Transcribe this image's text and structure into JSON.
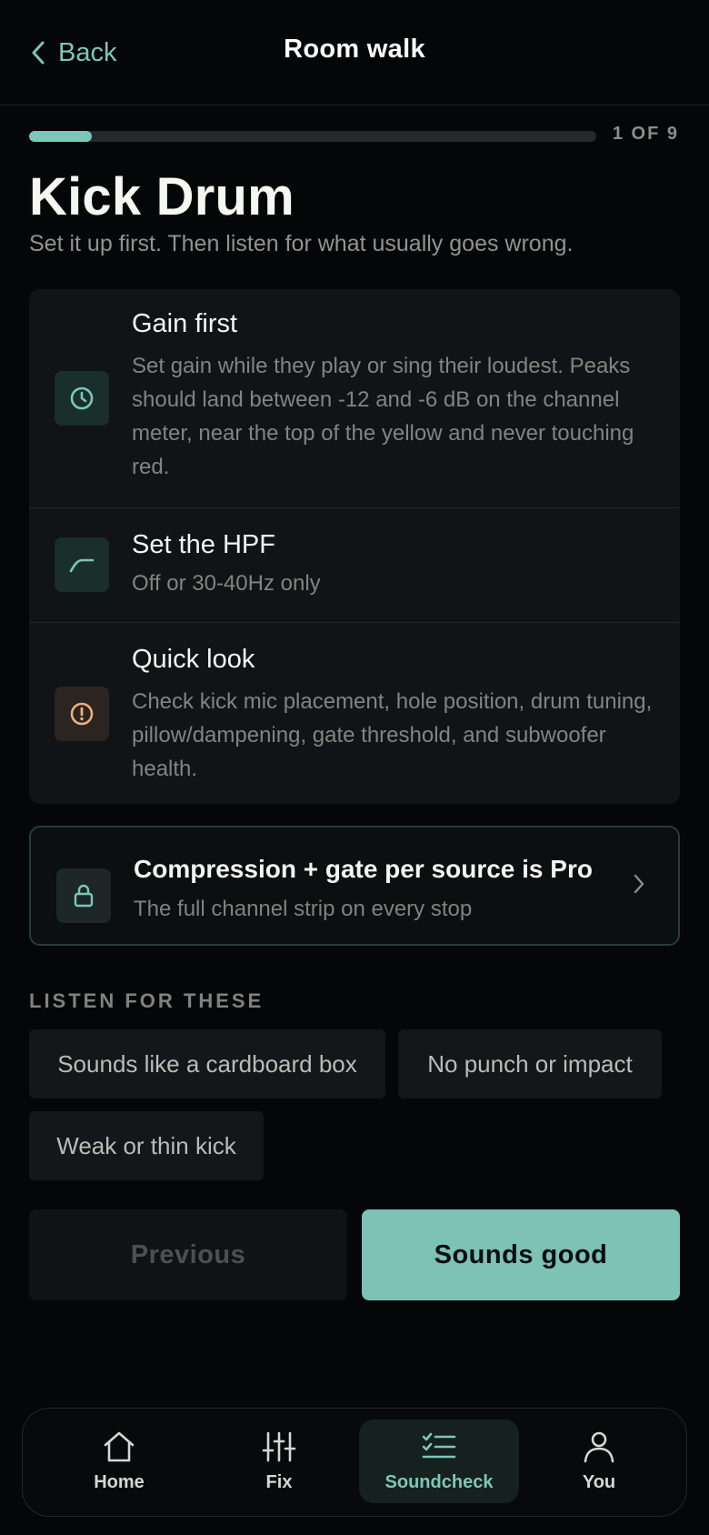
{
  "header": {
    "back_label": "Back",
    "title": "Room walk"
  },
  "progress": {
    "label": "1 OF 9",
    "current": 1,
    "total": 9
  },
  "page": {
    "title": "Kick Drum",
    "subtitle": "Set it up first. Then listen for what usually goes wrong."
  },
  "steps": [
    {
      "title": "Gain first",
      "body": "Set gain while they play or sing their loudest. Peaks should land between -12 and -6 dB on the channel meter, near the top of the yellow and never touching red.",
      "icon": "clock-icon"
    },
    {
      "title": "Set the HPF",
      "body": "Off or 30-40Hz only",
      "icon": "hpf-curve-icon"
    },
    {
      "title": "Quick look",
      "body": "Check kick mic placement, hole position, drum tuning, pillow/dampening, gate threshold, and subwoofer health.",
      "icon": "alert-icon"
    }
  ],
  "pro_banner": {
    "title": "Compression + gate per source is Pro",
    "subtitle": "The full channel strip on every stop",
    "icon": "lock-icon"
  },
  "listen": {
    "label": "LISTEN FOR THESE",
    "chips": [
      "Sounds like a cardboard box",
      "No punch or impact",
      "Weak or thin kick"
    ]
  },
  "buttons": {
    "previous": "Previous",
    "next": "Sounds good"
  },
  "nav": {
    "items": [
      {
        "label": "Home",
        "icon": "home-icon",
        "active": false
      },
      {
        "label": "Fix",
        "icon": "sliders-icon",
        "active": false
      },
      {
        "label": "Soundcheck",
        "icon": "checklist-icon",
        "active": true
      },
      {
        "label": "You",
        "icon": "user-icon",
        "active": false
      }
    ]
  },
  "colors": {
    "accent": "#7cc7b7",
    "background": "#050607",
    "card": "#111416",
    "warning": "#e8b07a"
  }
}
